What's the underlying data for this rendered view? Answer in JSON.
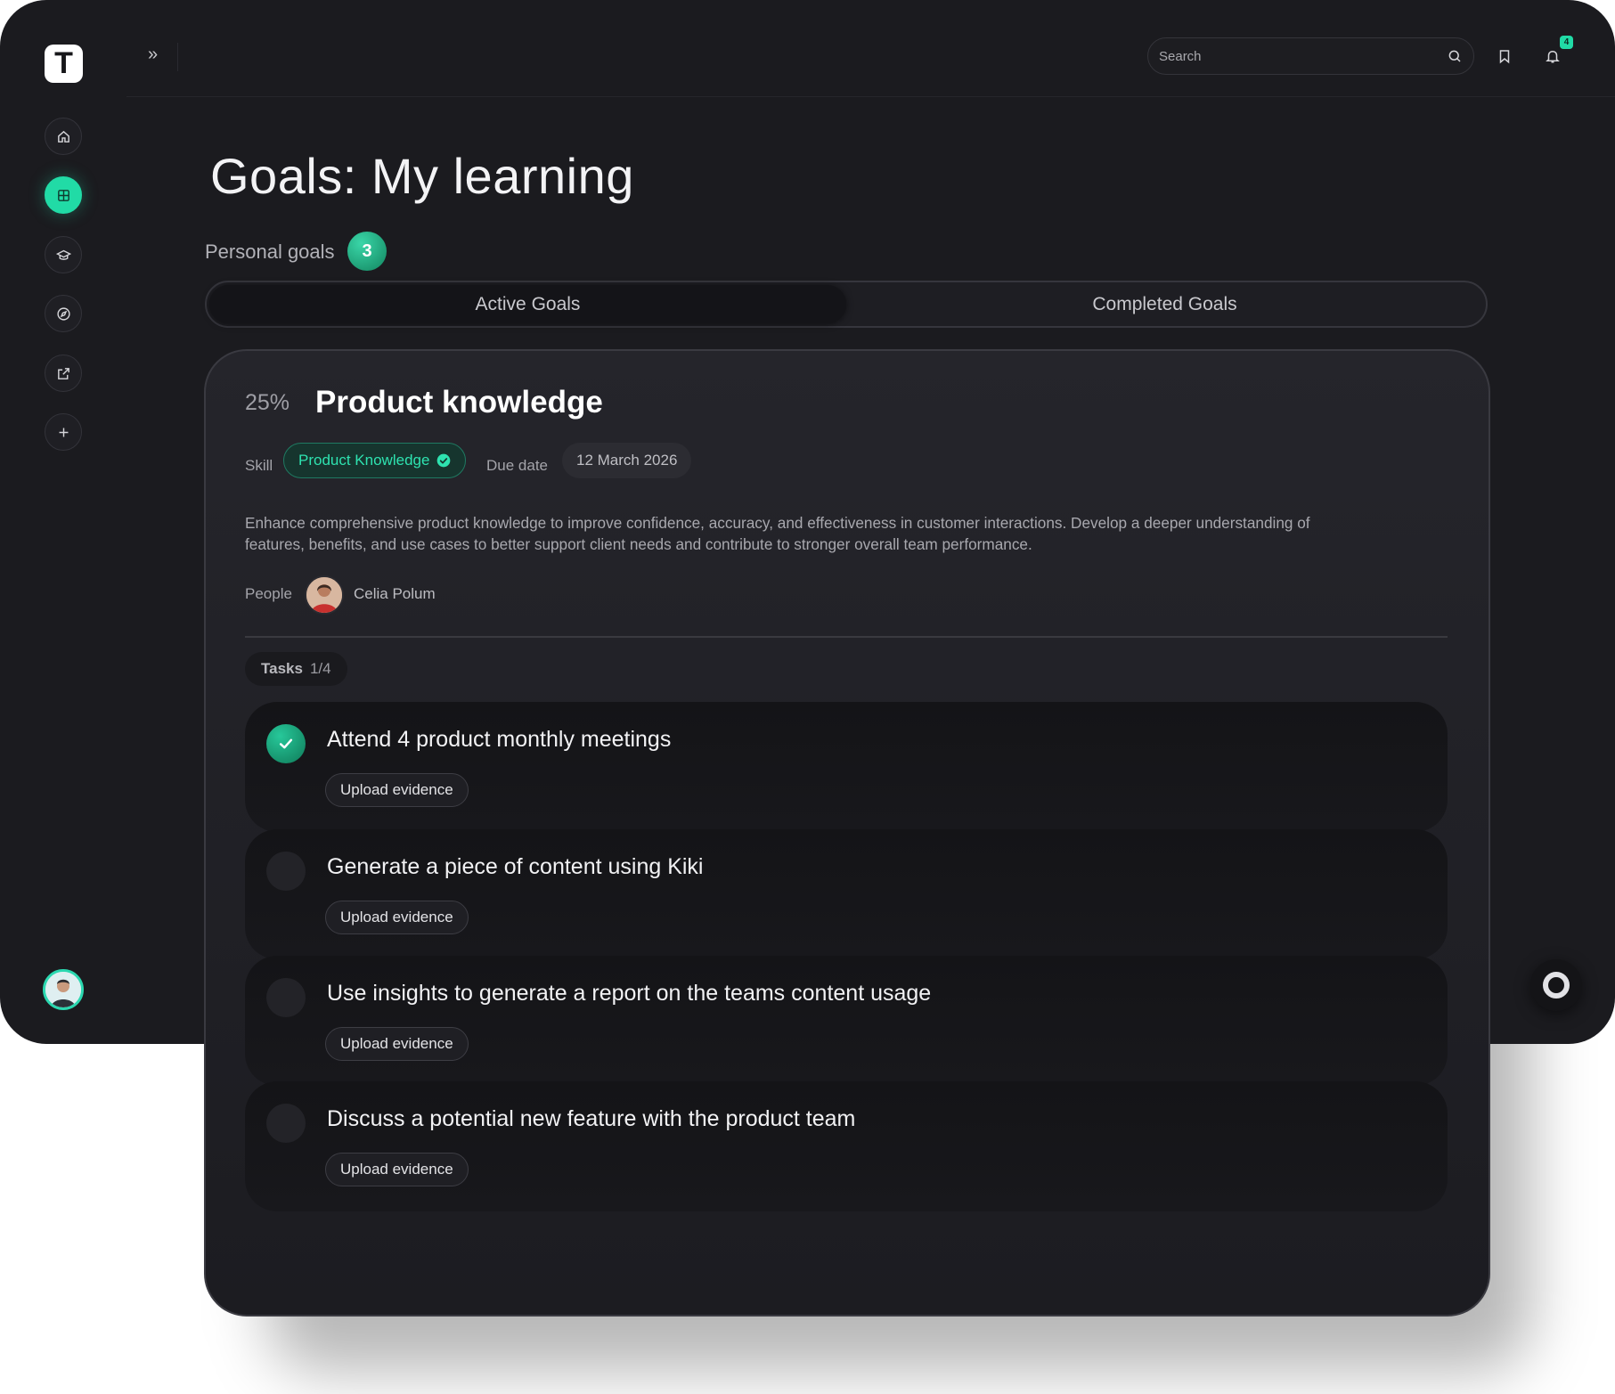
{
  "brand": {
    "logo_letter": "T",
    "accent": "#21dba6"
  },
  "sidebar": {
    "items": [
      {
        "name": "home",
        "icon": "home-icon",
        "active": false
      },
      {
        "name": "goals",
        "icon": "goals-grid-icon",
        "active": true
      },
      {
        "name": "learning",
        "icon": "graduation-cap-icon",
        "active": false
      },
      {
        "name": "explore",
        "icon": "compass-icon",
        "active": false
      },
      {
        "name": "external",
        "icon": "external-link-icon",
        "active": false
      },
      {
        "name": "add",
        "icon": "plus-icon",
        "active": false
      }
    ]
  },
  "topbar": {
    "expand_icon": "»",
    "search_placeholder": "Search",
    "notification_count": "4"
  },
  "page": {
    "title": "Goals: My learning",
    "personal_goals_label": "Personal goals",
    "personal_goals_count": "3"
  },
  "tabs": [
    {
      "label": "Active Goals",
      "active": true
    },
    {
      "label": "Completed Goals",
      "active": false
    }
  ],
  "goal": {
    "percent": "25%",
    "title": "Product knowledge",
    "skill_label": "Skill",
    "skill_value": "Product Knowledge",
    "due_label": "Due date",
    "due_value": "12 March 2026",
    "description": "Enhance comprehensive product knowledge to improve confidence, accuracy, and effectiveness in customer interactions. Develop a deeper understanding of features, benefits, and use cases to better support client needs and contribute to stronger overall team performance.",
    "people_label": "People",
    "person_name": "Celia Polum",
    "tasks_label": "Tasks",
    "tasks_count": "1/4",
    "tasks": [
      {
        "title": "Attend 4 product monthly meetings",
        "done": true,
        "button": "Upload evidence"
      },
      {
        "title": "Generate a piece of content using Kiki",
        "done": false,
        "button": "Upload evidence"
      },
      {
        "title": "Use insights to generate a report on the teams content usage",
        "done": false,
        "button": "Upload evidence"
      },
      {
        "title": "Discuss a potential new feature with the product team",
        "done": false,
        "button": "Upload evidence"
      }
    ]
  }
}
